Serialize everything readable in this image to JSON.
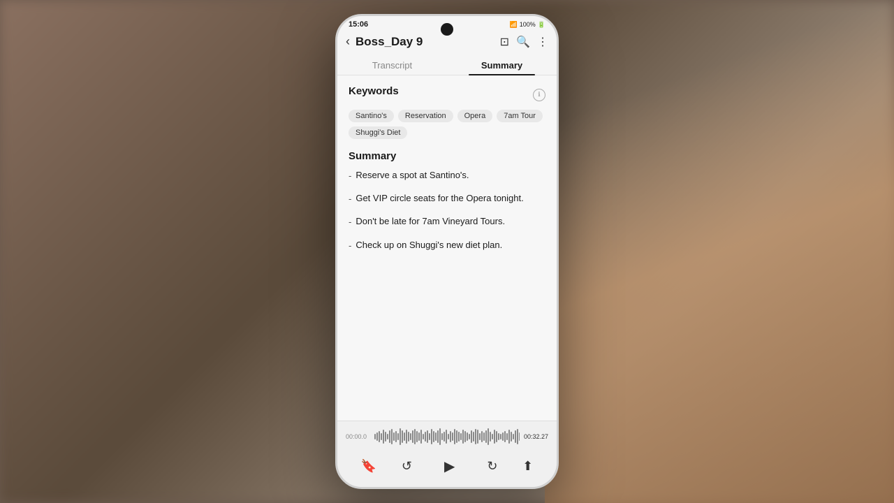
{
  "background": {
    "description": "blurred desk environment with hand holding phone"
  },
  "status_bar": {
    "time": "15:06",
    "signal_icon": "📶",
    "battery": "100%",
    "battery_icon": "🔋"
  },
  "top_bar": {
    "title": "Boss_Day 9",
    "back_label": "‹",
    "icon_save": "⊡",
    "icon_search": "🔍",
    "icon_more": "⋮"
  },
  "tabs": [
    {
      "label": "Transcript",
      "active": false
    },
    {
      "label": "Summary",
      "active": true
    }
  ],
  "keywords": {
    "section_title": "Keywords",
    "chips": [
      "Santino's",
      "Reservation",
      "Opera",
      "7am Tour",
      "Shuggi's Diet"
    ]
  },
  "summary": {
    "section_title": "Summary",
    "items": [
      "Reserve a spot at Santino's.",
      "Get VIP circle seats for the Opera tonight.",
      "Don't be late for 7am Vineyard Tours.",
      "Check up on Shuggi's new diet plan."
    ]
  },
  "audio_player": {
    "time_start": "00:00.0",
    "time_end": "00:32.27",
    "controls": {
      "bookmark": "🔖",
      "rewind": "↺",
      "play": "▶",
      "forward": "↻",
      "share": "⬆"
    }
  }
}
